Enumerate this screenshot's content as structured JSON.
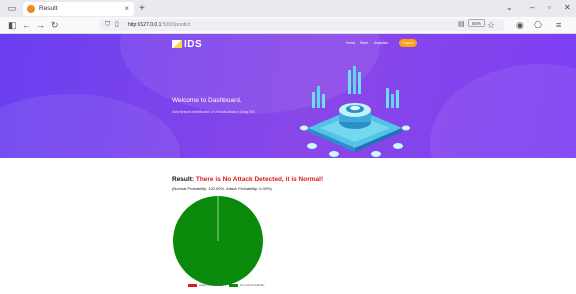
{
  "browser": {
    "tab_title": "Result",
    "tab_close": "×",
    "new_tab": "+",
    "url_host": "http://127.0.0.1",
    "url_path": ":5000/predict",
    "zoom": "50%"
  },
  "site": {
    "brand": "IDS",
    "nav": [
      "Home",
      "Store",
      "Analytics"
    ],
    "button": "Logout",
    "welcome": "Welcome to Dashboard.",
    "tagline": "Data Network Identification of Unusual Attack in Using IDS"
  },
  "result": {
    "label": "Result:",
    "message": "There is No Attack Detected, it is Normal!",
    "probabilities": "(Normal Probability: 100.00%, Attack Probability: 0.00%)"
  },
  "chart_data": {
    "type": "pie",
    "categories": [
      "Attack Probability",
      "Normal Probability"
    ],
    "values": [
      0,
      100
    ],
    "colors": [
      "#e01818",
      "#0a8a0a"
    ]
  },
  "colors": {
    "hero_start": "#6a3ff0",
    "hero_end": "#8a47e8",
    "accent_button": "#ff9f1a",
    "result_text": "#e01818"
  }
}
